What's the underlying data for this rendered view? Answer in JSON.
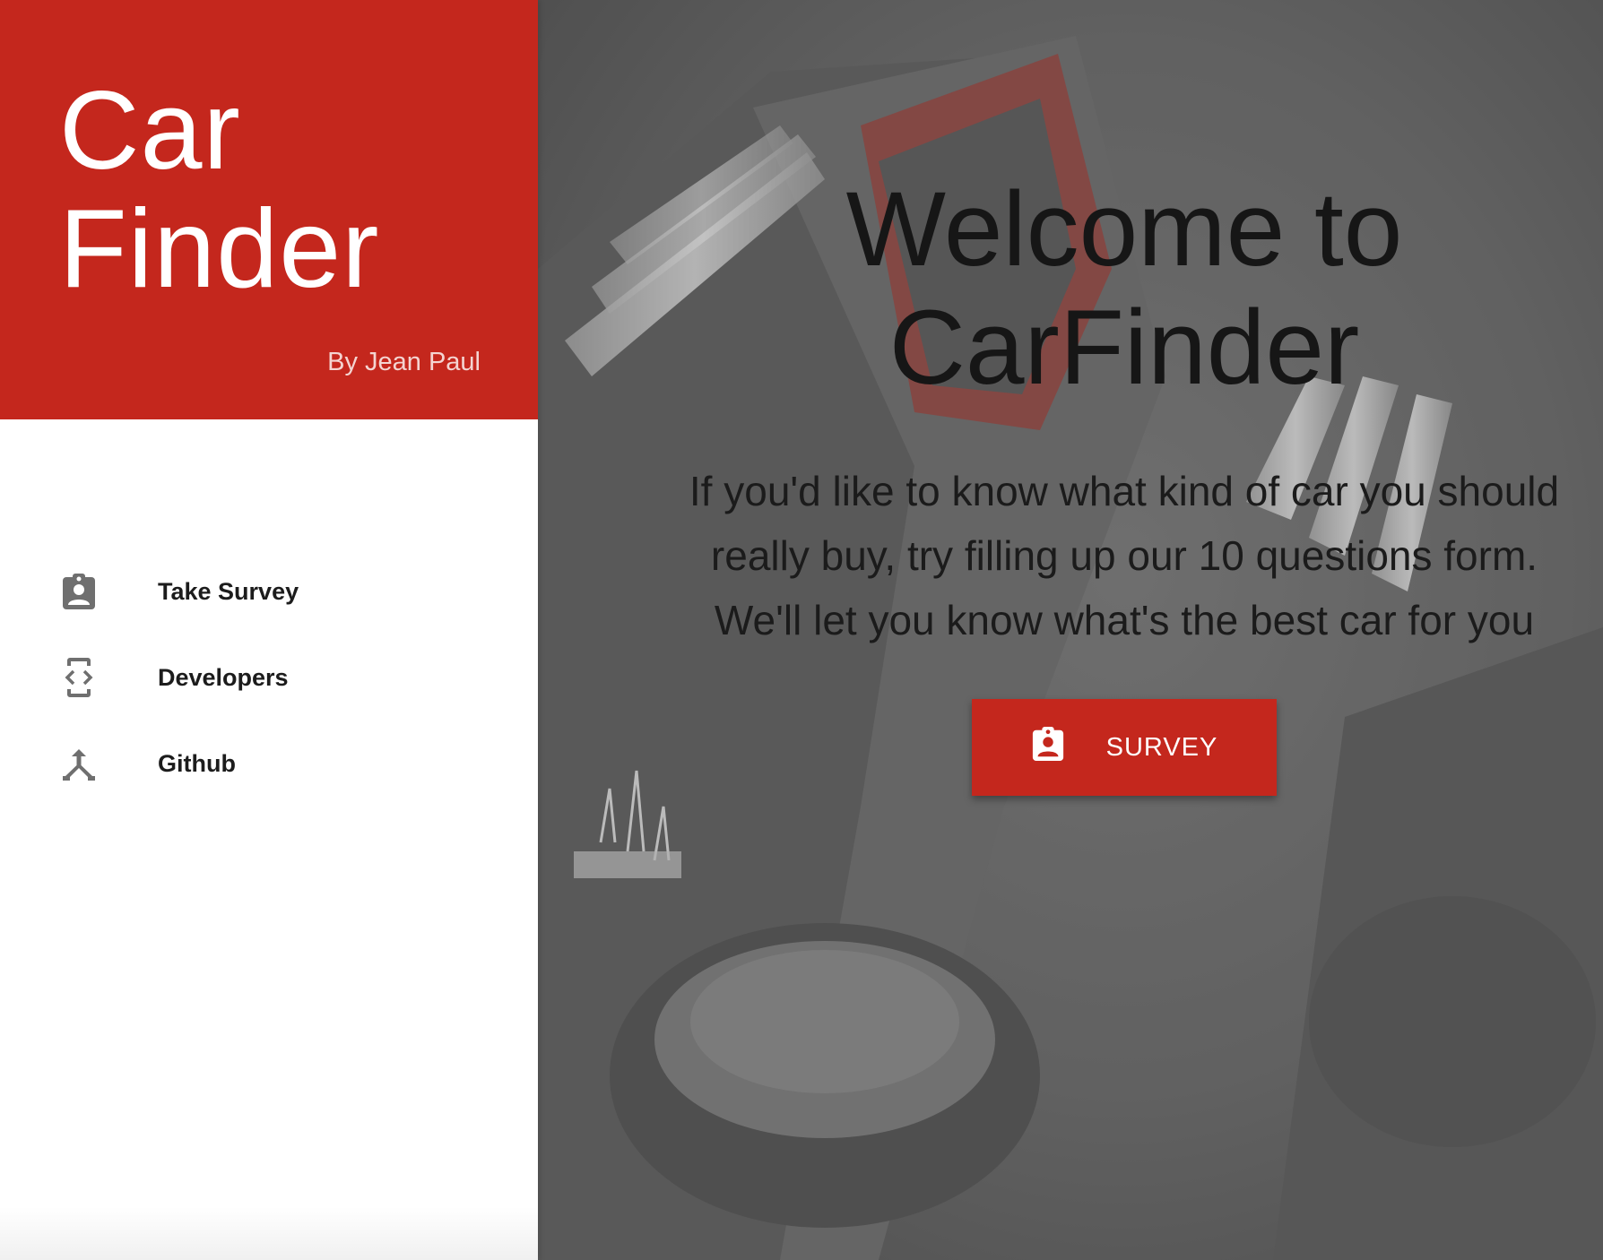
{
  "sidebar": {
    "brand": {
      "title_line1": "Car",
      "title_line2": "Finder",
      "author": "By Jean Paul"
    },
    "nav": [
      {
        "label": "Take Survey",
        "icon": "assignment-ind-icon"
      },
      {
        "label": "Developers",
        "icon": "developer-mode-icon"
      },
      {
        "label": "Github",
        "icon": "merge-type-icon"
      }
    ]
  },
  "hero": {
    "title": "Welcome to CarFinder",
    "description": "If you'd like to know what kind of car you should really buy, try filling up our 10 questions form. We'll let you know what's the best car for you",
    "button_label": "SURVEY",
    "button_icon": "assignment-ind-icon"
  },
  "colors": {
    "brand_red": "#c4271d",
    "icon_gray": "#6f6f6f"
  }
}
